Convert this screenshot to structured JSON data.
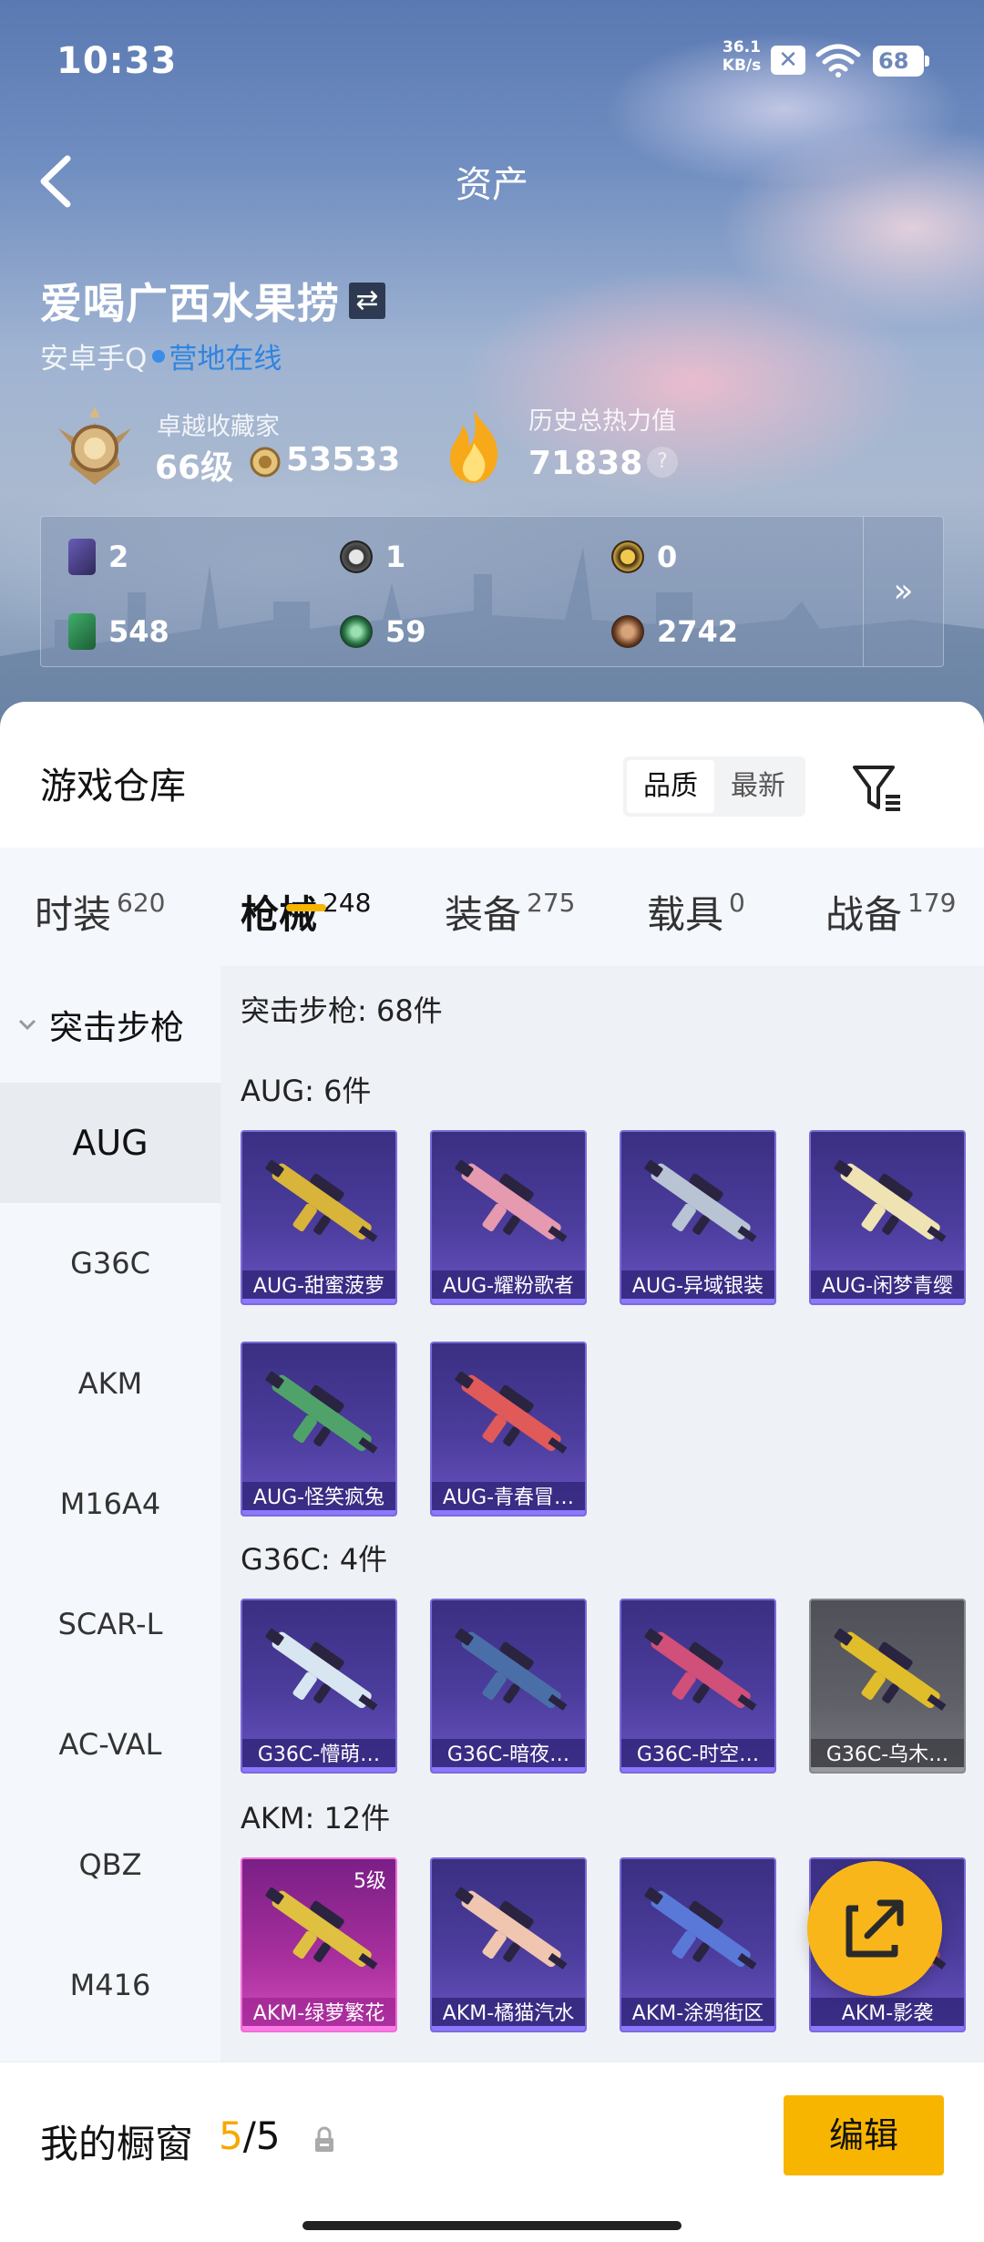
{
  "status_bar": {
    "time": "10:33",
    "net_speed_value": "36.1",
    "net_speed_unit": "KB/s",
    "battery": "68"
  },
  "header": {
    "title": "资产"
  },
  "profile": {
    "name": "爱喝广西水果捞",
    "server": "安卓手Q",
    "online_status": "营地在线",
    "collector_title": "卓越收藏家",
    "collector_level": "66级",
    "collector_points": "53533",
    "heat_title": "历史总热力值",
    "heat_value": "71838",
    "heat_help": "?"
  },
  "stats": [
    {
      "icon": "purple-card-icon",
      "value": "2"
    },
    {
      "icon": "silver-coin-icon",
      "value": "1"
    },
    {
      "icon": "gold-coin-icon",
      "value": "0"
    },
    {
      "icon": "green-card-icon",
      "value": "548"
    },
    {
      "icon": "green-gem-icon",
      "value": "59"
    },
    {
      "icon": "bronze-coin-icon",
      "value": "2742"
    }
  ],
  "stats_more": "»",
  "warehouse": {
    "title": "游戏仓库",
    "sort_options": [
      "品质",
      "最新"
    ],
    "sort_active": 0
  },
  "tabs": [
    {
      "label": "时装",
      "count": "620"
    },
    {
      "label": "枪械",
      "count": "248",
      "active": true
    },
    {
      "label": "装备",
      "count": "275"
    },
    {
      "label": "载具",
      "count": "0"
    },
    {
      "label": "战备",
      "count": "179"
    }
  ],
  "sidebar": {
    "category": "突击步枪",
    "items": [
      "AUG",
      "G36C",
      "AKM",
      "M16A4",
      "SCAR-L",
      "AC-VAL",
      "QBZ",
      "M416"
    ],
    "active": "AUG"
  },
  "content": {
    "category_summary": "突击步枪: 68件",
    "sections": [
      {
        "title": "AUG: 6件",
        "items": [
          "AUG-甜蜜菠萝",
          "AUG-耀粉歌者",
          "AUG-异域银装",
          "AUG-闲梦青缨",
          "AUG-怪笑疯兔",
          "AUG-青春冒…"
        ]
      },
      {
        "title": "G36C: 4件",
        "items": [
          "G36C-懵萌…",
          "G36C-暗夜…",
          "G36C-时空…",
          "G36C-乌木…"
        ]
      },
      {
        "title": "AKM: 12件",
        "items": [
          "AKM-绿萝繁花",
          "AKM-橘猫汽水",
          "AKM-涂鸦街区",
          "AKM-影袭"
        ],
        "first_level": "5级"
      }
    ]
  },
  "colors": {
    "accent": "#f8b500",
    "online": "#2f84e0",
    "card_purple": "#4c3d9d"
  },
  "bottom": {
    "label": "我的橱窗",
    "current": "5",
    "total": "/5",
    "edit": "编辑"
  }
}
